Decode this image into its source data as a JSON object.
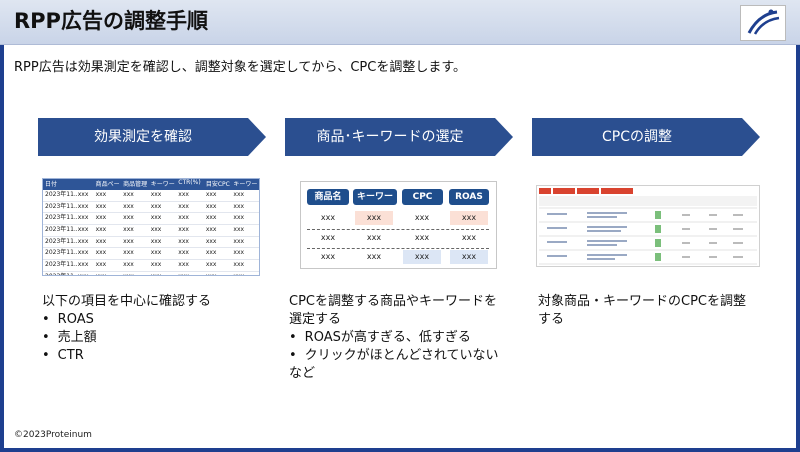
{
  "title": "RPP広告の調整手順",
  "subtitle": "RPP広告は効果測定を確認し、調整対象を選定してから、CPCを調整します。",
  "steps": [
    {
      "label": "効果測定を確認"
    },
    {
      "label": "商品･キーワードの選定"
    },
    {
      "label": "CPCの調整"
    }
  ],
  "step1_table": {
    "headers": [
      "日付",
      "商品ペー",
      "商品管理",
      "キーワー",
      "CTR(%)",
      "目安CPC",
      "キーワード"
    ],
    "rows": [
      [
        "2023年11..xxx",
        "xxx",
        "xxx",
        "xxx",
        "xxx",
        "xxx",
        "xxx"
      ],
      [
        "2023年11..xxx",
        "xxx",
        "xxx",
        "xxx",
        "xxx",
        "xxx",
        "xxx"
      ],
      [
        "2023年11..xxx",
        "xxx",
        "xxx",
        "xxx",
        "xxx",
        "xxx",
        "xxx"
      ],
      [
        "2023年11..xxx",
        "xxx",
        "xxx",
        "xxx",
        "xxx",
        "xxx",
        "xxx"
      ],
      [
        "2023年11..xxx",
        "xxx",
        "xxx",
        "xxx",
        "xxx",
        "xxx",
        "xxx"
      ],
      [
        "2023年11..xxx",
        "xxx",
        "xxx",
        "xxx",
        "xxx",
        "xxx",
        "xxx"
      ],
      [
        "2023年11..xxx",
        "xxx",
        "xxx",
        "xxx",
        "xxx",
        "xxx",
        "xxx"
      ],
      [
        "2023年11..xxx",
        "xxx",
        "xxx",
        "xxx",
        "xxx",
        "xxx",
        "xxx"
      ]
    ]
  },
  "step2_table": {
    "headers": [
      "商品名",
      "キーワード",
      "CPC",
      "ROAS"
    ],
    "rows": [
      [
        "xxx",
        "xxx",
        "xxx",
        "xxx"
      ],
      [
        "xxx",
        "xxx",
        "xxx",
        "xxx"
      ],
      [
        "xxx",
        "xxx",
        "xxx",
        "xxx"
      ]
    ]
  },
  "desc1": {
    "lead": "以下の項目を中心に確認する",
    "items": [
      "ROAS",
      "売上額",
      "CTR"
    ]
  },
  "desc2": {
    "lead1": "CPCを調整する商品やキーワードを",
    "lead2": "選定する",
    "item1": "ROASが高すぎる、低すぎる",
    "item2": "クリックがほとんどされていない",
    "tail": "など"
  },
  "desc3": {
    "line1": "対象商品・キーワードのCPCを調整",
    "line2": "する"
  },
  "footer": "©2023Proteinum",
  "colors": {
    "chevron": "#2b4f90",
    "header": "#1f4e8c",
    "highlight_red": "#fbe0d6",
    "highlight_blue": "#dce6f5"
  }
}
